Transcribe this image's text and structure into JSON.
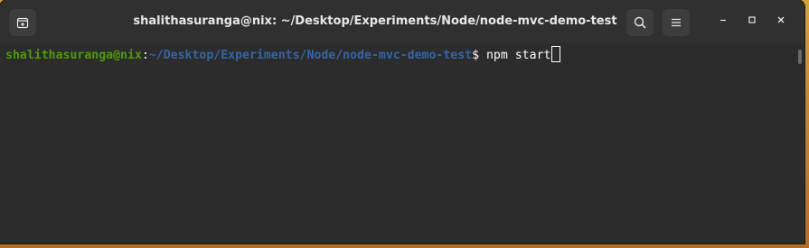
{
  "window": {
    "title": "shalithasuranga@nix: ~/Desktop/Experiments/Node/node-mvc-demo-test"
  },
  "toolbar": {
    "new_tab_icon": "new-tab-icon",
    "search_icon": "search-icon",
    "menu_icon": "hamburger-menu-icon",
    "minimize_icon": "minimize-icon",
    "maximize_icon": "maximize-icon",
    "close_icon": "close-icon"
  },
  "terminal": {
    "prompt_user": "shalithasuranga@nix",
    "prompt_colon": ":",
    "prompt_path": "~/Desktop/Experiments/Node/node-mvc-demo-test",
    "prompt_symbol": "$",
    "command": " npm start"
  },
  "colors": {
    "user": "#4e9a06",
    "path": "#3465a4",
    "background": "#2c2c2c",
    "titlebar": "#303030"
  }
}
